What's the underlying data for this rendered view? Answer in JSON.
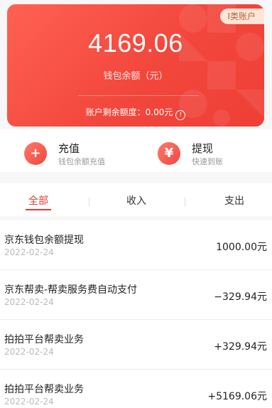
{
  "card": {
    "badge": "Ⅰ类账户",
    "balance": "4169.06",
    "balance_label": "钱包余额（元）",
    "remaining_text": "账户剩余额度：0.00元",
    "info_icon": "!",
    "accent_start": "#ff6152",
    "accent_end": "#ee3f36"
  },
  "actions": [
    {
      "icon": "plus-icon",
      "glyph": "+",
      "title": "充值",
      "subtitle": "钱包余额充值"
    },
    {
      "icon": "yen-icon",
      "glyph": "¥",
      "title": "提现",
      "subtitle": "快速到账"
    }
  ],
  "tabs": [
    {
      "label": "全部",
      "active": true
    },
    {
      "label": "收入",
      "active": false
    },
    {
      "label": "支出",
      "active": false
    }
  ],
  "transactions": [
    {
      "title": "京东钱包余额提现",
      "date": "2022-02-24",
      "amount": "1000.00元"
    },
    {
      "title": "京东帮卖-帮卖服务费自动支付",
      "date": "2022-02-24",
      "amount": "−329.94元"
    },
    {
      "title": "拍拍平台帮卖业务",
      "date": "2022-02-24",
      "amount": "+329.94元"
    },
    {
      "title": "拍拍平台帮卖业务",
      "date": "2022-02-24",
      "amount": "+5169.06元"
    }
  ]
}
